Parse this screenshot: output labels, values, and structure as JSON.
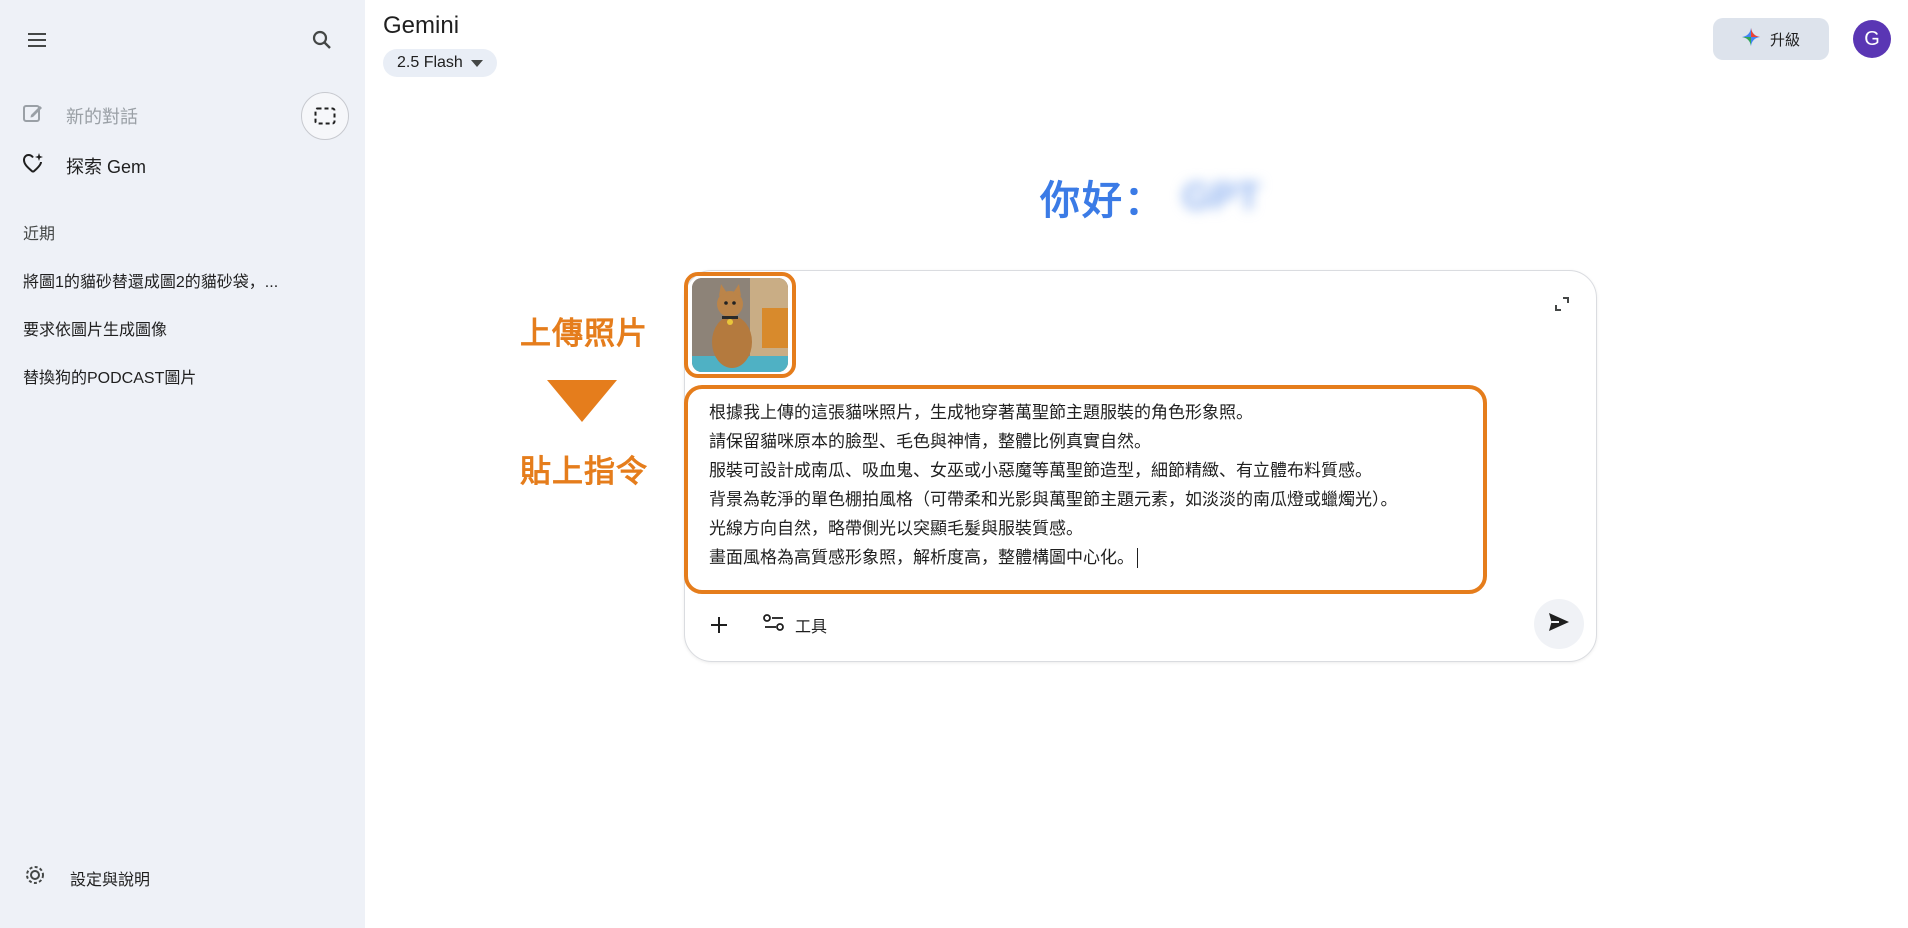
{
  "sidebar": {
    "new_chat_label": "新的對話",
    "explore_gem_label": "探索 Gem",
    "recent_heading": "近期",
    "recent_items": [
      {
        "label": "將圖1的貓砂替還成圖2的貓砂袋，..."
      },
      {
        "label": "要求依圖片生成圖像"
      },
      {
        "label": "替換狗的PODCAST圖片"
      }
    ],
    "settings_label": "設定與說明"
  },
  "header": {
    "title": "Gemini",
    "model": "2.5 Flash",
    "upgrade_label": "升級",
    "avatar_letter": "G"
  },
  "greeting": {
    "text": "你好：",
    "name": "GPT"
  },
  "annotations": {
    "upload_label": "上傳照片",
    "paste_label": "貼上指令",
    "color": "#e57d1c"
  },
  "input": {
    "prompt_lines": [
      "根據我上傳的這張貓咪照片，生成牠穿著萬聖節主題服裝的角色形象照。",
      "請保留貓咪原本的臉型、毛色與神情，整體比例真實自然。",
      "服裝可設計成南瓜、吸血鬼、女巫或小惡魔等萬聖節造型，細節精緻、有立體布料質感。",
      "背景為乾淨的單色棚拍風格（可帶柔和光影與萬聖節主題元素，如淡淡的南瓜燈或蠟燭光）。",
      "光線方向自然，略帶側光以突顯毛髮與服裝質感。",
      "畫面風格為高質感形象照，解析度高，整體構圖中心化。"
    ],
    "tools_label": "工具"
  },
  "colors": {
    "sidebar_bg": "#eef1f7",
    "greeting": "#3b7be6",
    "avatar": "#5a36b4"
  }
}
